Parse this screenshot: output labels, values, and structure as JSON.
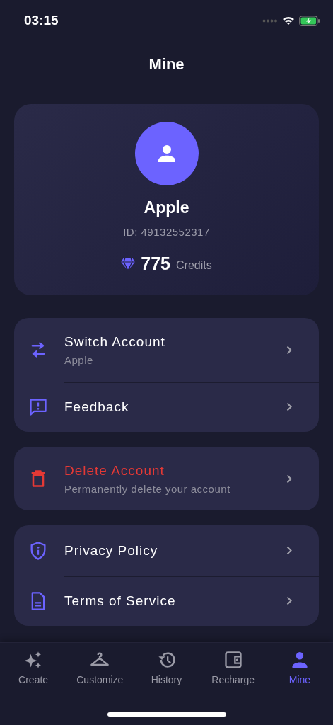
{
  "status_bar": {
    "time": "03:15"
  },
  "header": {
    "title": "Mine"
  },
  "profile": {
    "name": "Apple",
    "id": "ID: 49132552317",
    "credits": "775",
    "credits_label": "Credits"
  },
  "menu_groups": [
    {
      "items": [
        {
          "kind": "normal",
          "title": "Switch Account",
          "subtitle": "Apple"
        },
        {
          "kind": "normal",
          "title": "Feedback"
        }
      ]
    },
    {
      "items": [
        {
          "kind": "danger",
          "title": "Delete Account",
          "subtitle": "Permanently delete your account"
        }
      ]
    },
    {
      "items": [
        {
          "kind": "normal",
          "title": "Privacy Policy"
        },
        {
          "kind": "normal",
          "title": "Terms of Service"
        }
      ]
    }
  ],
  "tab_bar": [
    {
      "label": "Create",
      "selected": false
    },
    {
      "label": "Customize",
      "selected": false
    },
    {
      "label": "History",
      "selected": false
    },
    {
      "label": "Recharge",
      "selected": false
    },
    {
      "label": "Mine",
      "selected": true
    }
  ]
}
